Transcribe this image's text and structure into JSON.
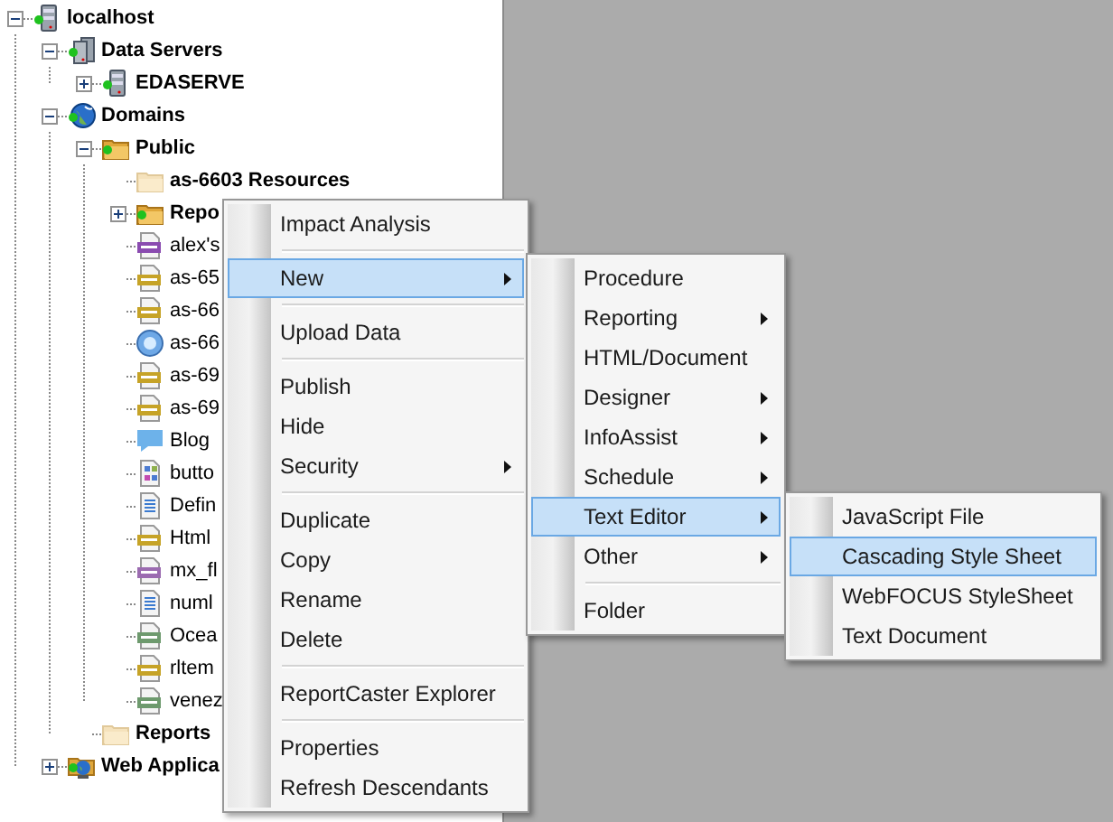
{
  "tree": [
    {
      "label": "localhost",
      "kind": "server",
      "bold": true,
      "expanded": true,
      "children": [
        {
          "label": "Data Servers",
          "kind": "servers",
          "bold": true,
          "expanded": true,
          "children": [
            {
              "label": "EDASERVE",
              "kind": "server",
              "bold": true,
              "expanded": false
            }
          ]
        },
        {
          "label": "Domains",
          "kind": "globe",
          "bold": true,
          "expanded": true,
          "children": [
            {
              "label": "Public",
              "kind": "folder",
              "bold": true,
              "expanded": true,
              "children": [
                {
                  "label": "as-6603 Resources",
                  "kind": "faded",
                  "bold": true
                },
                {
                  "label": "Repo",
                  "kind": "folder",
                  "bold": true,
                  "expanded": false
                },
                {
                  "label": "alex's",
                  "kind": "url",
                  "bold": false
                },
                {
                  "label": "as-65",
                  "kind": "html",
                  "bold": false
                },
                {
                  "label": "as-66",
                  "kind": "html",
                  "bold": false
                },
                {
                  "label": "as-66",
                  "kind": "orb",
                  "bold": false
                },
                {
                  "label": "as-69",
                  "kind": "html",
                  "bold": false
                },
                {
                  "label": "as-69",
                  "kind": "html",
                  "bold": false
                },
                {
                  "label": "Blog",
                  "kind": "chat",
                  "bold": false
                },
                {
                  "label": "butto",
                  "kind": "form",
                  "bold": false
                },
                {
                  "label": "Defin",
                  "kind": "page",
                  "bold": false
                },
                {
                  "label": "Html",
                  "kind": "html",
                  "bold": false
                },
                {
                  "label": "mx_fl",
                  "kind": "png",
                  "bold": false
                },
                {
                  "label": "numl",
                  "kind": "page",
                  "bold": false
                },
                {
                  "label": "Ocea",
                  "kind": "jpeg",
                  "bold": false
                },
                {
                  "label": "rltem",
                  "kind": "html",
                  "bold": false
                },
                {
                  "label": "venez",
                  "kind": "jpeg",
                  "bold": false
                }
              ]
            },
            {
              "label": "Reports",
              "kind": "faded",
              "bold": true
            }
          ]
        },
        {
          "label": "Web Applica",
          "kind": "webapp",
          "bold": true,
          "expanded": false
        }
      ]
    }
  ],
  "menus": [
    {
      "items": [
        {
          "kind": "item",
          "label": "Impact Analysis",
          "selected": false,
          "submenu": false
        },
        {
          "kind": "separator"
        },
        {
          "kind": "item",
          "label": "New",
          "selected": true,
          "submenu": true
        },
        {
          "kind": "separator"
        },
        {
          "kind": "item",
          "label": "Upload Data",
          "selected": false,
          "submenu": false
        },
        {
          "kind": "separator"
        },
        {
          "kind": "item",
          "label": "Publish",
          "selected": false,
          "submenu": false
        },
        {
          "kind": "item",
          "label": "Hide",
          "selected": false,
          "submenu": false
        },
        {
          "kind": "item",
          "label": "Security",
          "selected": false,
          "submenu": true
        },
        {
          "kind": "separator"
        },
        {
          "kind": "item",
          "label": "Duplicate",
          "selected": false,
          "submenu": false
        },
        {
          "kind": "item",
          "label": "Copy",
          "selected": false,
          "submenu": false
        },
        {
          "kind": "item",
          "label": "Rename",
          "selected": false,
          "submenu": false
        },
        {
          "kind": "item",
          "label": "Delete",
          "selected": false,
          "submenu": false
        },
        {
          "kind": "separator"
        },
        {
          "kind": "item",
          "label": "ReportCaster Explorer",
          "selected": false,
          "submenu": false
        },
        {
          "kind": "separator"
        },
        {
          "kind": "item",
          "label": "Properties",
          "selected": false,
          "submenu": false
        },
        {
          "kind": "item",
          "label": "Refresh Descendants",
          "selected": false,
          "submenu": false
        }
      ]
    },
    {
      "items": [
        {
          "kind": "item",
          "label": "Procedure",
          "selected": false,
          "submenu": false
        },
        {
          "kind": "item",
          "label": "Reporting",
          "selected": false,
          "submenu": true
        },
        {
          "kind": "item",
          "label": "HTML/Document",
          "selected": false,
          "submenu": false
        },
        {
          "kind": "item",
          "label": "Designer",
          "selected": false,
          "submenu": true
        },
        {
          "kind": "item",
          "label": "InfoAssist",
          "selected": false,
          "submenu": true
        },
        {
          "kind": "item",
          "label": "Schedule",
          "selected": false,
          "submenu": true
        },
        {
          "kind": "item",
          "label": "Text Editor",
          "selected": true,
          "submenu": true
        },
        {
          "kind": "item",
          "label": "Other",
          "selected": false,
          "submenu": true
        },
        {
          "kind": "separator"
        },
        {
          "kind": "item",
          "label": "Folder",
          "selected": false,
          "submenu": false
        }
      ]
    },
    {
      "items": [
        {
          "kind": "item",
          "label": "JavaScript File",
          "selected": false,
          "submenu": false
        },
        {
          "kind": "item",
          "label": "Cascading Style Sheet",
          "selected": true,
          "submenu": false
        },
        {
          "kind": "item",
          "label": "WebFOCUS StyleSheet",
          "selected": false,
          "submenu": false
        },
        {
          "kind": "item",
          "label": "Text Document",
          "selected": false,
          "submenu": false
        }
      ]
    }
  ]
}
